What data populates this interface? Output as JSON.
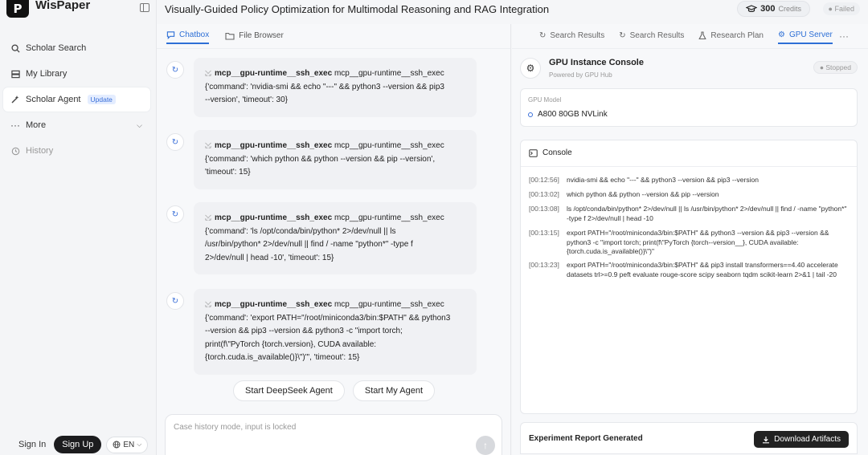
{
  "app": {
    "logo_letter": "P",
    "name": "WisPaper"
  },
  "sidebar": {
    "items": [
      {
        "label": "Scholar Search",
        "icon": "search-icon"
      },
      {
        "label": "My Library",
        "icon": "library-icon"
      },
      {
        "label": "Scholar Agent",
        "icon": "sparkle-icon",
        "badge": "Update"
      },
      {
        "label": "More",
        "icon": "dots-icon"
      },
      {
        "label": "History",
        "icon": "clock-icon"
      }
    ],
    "footer": {
      "sign_in": "Sign In",
      "sign_up": "Sign Up",
      "lang": "EN"
    }
  },
  "header": {
    "title": "Visually-Guided Policy Optimization for Multimodal Reasoning and RAG Integration",
    "credits_value": "300",
    "credits_unit": "Credits",
    "status": "Failed"
  },
  "chat": {
    "tabs": [
      {
        "label": "Chatbox"
      },
      {
        "label": "File Browser"
      }
    ],
    "messages": [
      {
        "tool": "mcp__gpu-runtime__ssh_exec",
        "lines": [
          "mcp__gpu-runtime__ssh_exec",
          "{'command': 'nvidia-smi && echo \"---\" && python3 --version && pip3",
          "--version', 'timeout': 30}"
        ]
      },
      {
        "tool": "mcp__gpu-runtime__ssh_exec",
        "lines": [
          "mcp__gpu-runtime__ssh_exec",
          "{'command': 'which python && python --version && pip --version',",
          "'timeout': 15}"
        ]
      },
      {
        "tool": "mcp__gpu-runtime__ssh_exec",
        "lines": [
          "mcp__gpu-runtime__ssh_exec",
          "{'command': 'ls /opt/conda/bin/python* 2>/dev/null || ls",
          "/usr/bin/python* 2>/dev/null || find / -name \"python*\" -type f",
          "2>/dev/null | head -10', 'timeout': 15}"
        ]
      },
      {
        "tool": "mcp__gpu-runtime__ssh_exec",
        "lines": [
          "mcp__gpu-runtime__ssh_exec",
          "{'command': 'export PATH=\"/root/miniconda3/bin:$PATH\" && python3",
          "--version && pip3 --version && python3 -c \"import torch;",
          "print(f\\\"PyTorch {torch.version}, CUDA available:",
          "{torch.cuda.is_available()}\\\")\"', 'timeout': 15}"
        ]
      }
    ],
    "buttons": {
      "deepseek": "Start DeepSeek Agent",
      "my_agent": "Start My Agent"
    },
    "input_placeholder": "Case history mode, input is locked"
  },
  "right": {
    "tabs": [
      {
        "label": "Search Results"
      },
      {
        "label": "Search Results"
      },
      {
        "label": "Research Plan"
      },
      {
        "label": "GPU Server"
      }
    ],
    "console": {
      "title": "GPU Instance Console",
      "subtitle": "Powered by GPU Hub",
      "status": "Stopped",
      "model_label": "GPU Model",
      "model_value": "A800 80GB NVLink",
      "label": "Console",
      "logs": [
        {
          "ts": "[00:12:56]",
          "cmd": "nvidia-smi && echo \"---\" && python3 --version && pip3 --version"
        },
        {
          "ts": "[00:13:02]",
          "cmd": "which python && python --version && pip --version"
        },
        {
          "ts": "[00:13:08]",
          "cmd": "ls /opt/conda/bin/python* 2>/dev/null || ls /usr/bin/python* 2>/dev/null || find / -name \"python*\" -type f 2>/dev/null | head -10"
        },
        {
          "ts": "[00:13:15]",
          "cmd": "export PATH=\"/root/miniconda3/bin:$PATH\" && python3 --version && pip3 --version && python3 -c \"import torch; print(f\\\"PyTorch {torch--version__}, CUDA available: {torch.cuda.is_available()}\\\")\""
        },
        {
          "ts": "[00:13:23]",
          "cmd": "export PATH=\"/root/miniconda3/bin:$PATH\" && pip3 install transformers==4.40 accelerate datasets trl>=0.9 peft evaluate rouge-score scipy seaborn tqdm scikit-learn 2>&1 | tail -20"
        }
      ]
    },
    "report": {
      "title": "Experiment Report Generated",
      "download": "Download Artifacts"
    }
  }
}
